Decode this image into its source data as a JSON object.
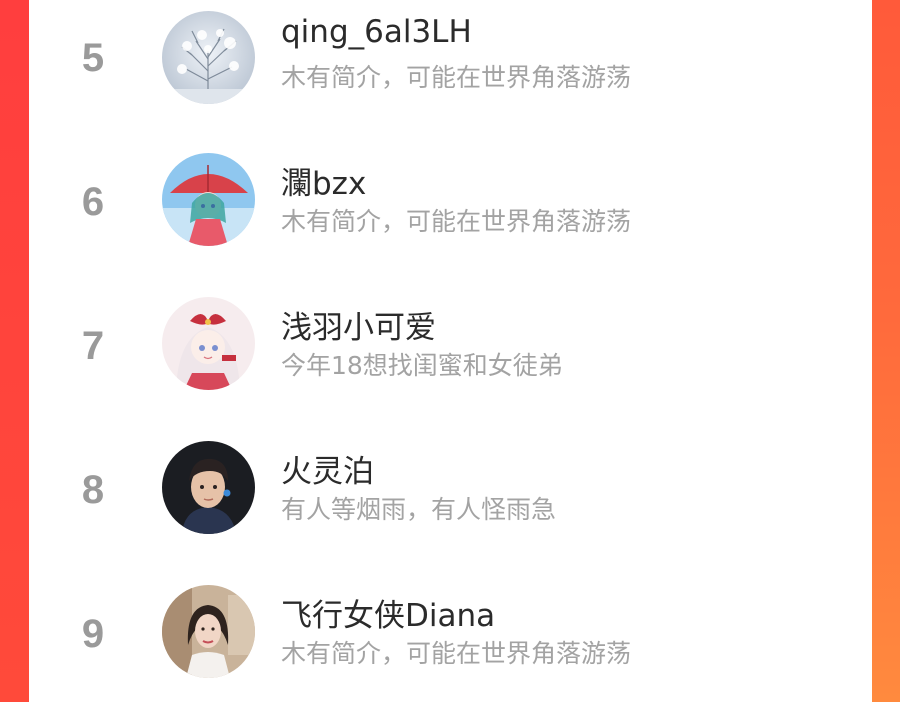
{
  "theme": {
    "accent_left": "#ff3e3e",
    "accent_right": "#ff8a3e",
    "rank_color": "#9a9a9a",
    "name_color": "#2b2b2b",
    "bio_color": "#a3a3a3"
  },
  "ranking": {
    "items": [
      {
        "rank": "5",
        "name": "qing_6al3LH",
        "bio": "木有简介，可能在世界角落游荡",
        "avatar_icon": "snowy-tree-avatar"
      },
      {
        "rank": "6",
        "name": "瀾bzx",
        "bio": "木有简介，可能在世界角落游荡",
        "avatar_icon": "anime-girl-umbrella-avatar"
      },
      {
        "rank": "7",
        "name": "浅羽小可爱",
        "bio": "今年18想找闺蜜和女徒弟",
        "avatar_icon": "anime-girl-bow-avatar"
      },
      {
        "rank": "8",
        "name": "火灵泊",
        "bio": "有人等烟雨，有人怪雨急",
        "avatar_icon": "young-man-portrait-avatar"
      },
      {
        "rank": "9",
        "name": "飞行女侠Diana",
        "bio": "木有简介，可能在世界角落游荡",
        "avatar_icon": "woman-portrait-avatar"
      }
    ]
  }
}
